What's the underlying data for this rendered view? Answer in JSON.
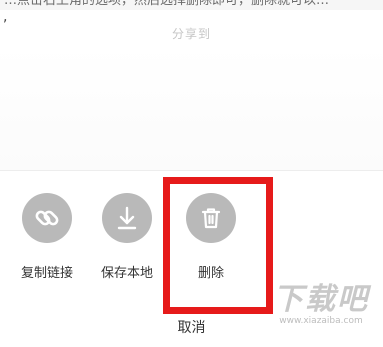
{
  "instruction_caption": "…点击右上角的选项，然后选择删除即可，删除就可以…",
  "trailing_punctuation": ",",
  "share_sheet": {
    "title": "分享到",
    "actions": [
      {
        "label": "复制链接",
        "icon": "link-icon"
      },
      {
        "label": "保存本地",
        "icon": "download-icon"
      },
      {
        "label": "删除",
        "icon": "trash-icon"
      }
    ],
    "cancel_label": "取消"
  },
  "highlight_color": "#e61a1a",
  "icon_circle_color": "#b9b9b9",
  "watermark": {
    "logo_text": "下载吧",
    "url": "www.xiazaiba.com"
  }
}
